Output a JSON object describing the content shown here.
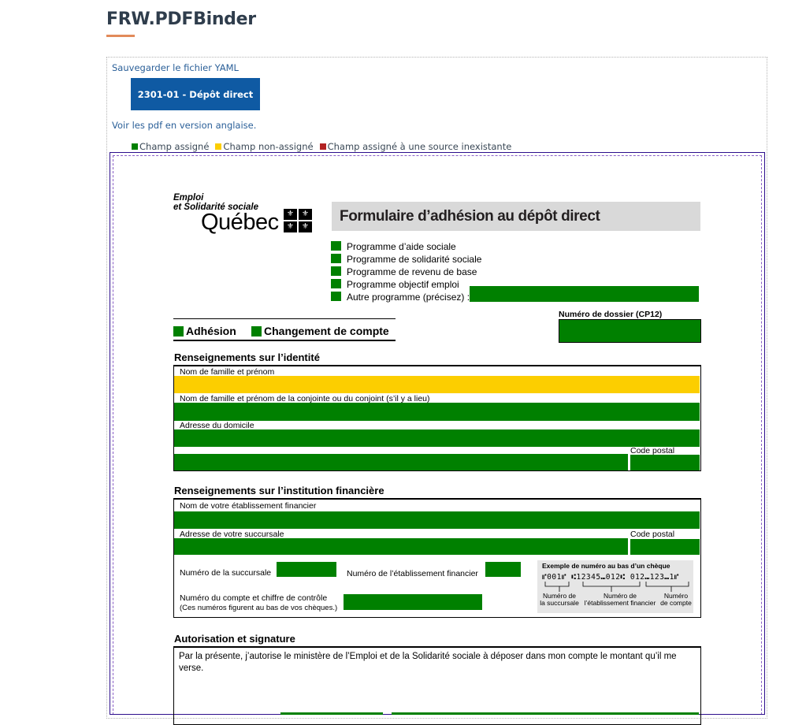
{
  "app": {
    "title": "FRW.PDFBinder"
  },
  "links": {
    "save_yaml": "Sauvegarder le fichier YAML",
    "view_english": "Voir les pdf en version anglaise."
  },
  "document_button": {
    "label": "2301-01 - Dépôt direct"
  },
  "legend": {
    "items": [
      {
        "label": "Champ assigné",
        "color": "#008000"
      },
      {
        "label": "Champ non-assigné",
        "color": "#fcce00"
      },
      {
        "label": "Champ assigné à une source inexistante",
        "color": "#b22222"
      }
    ]
  },
  "pdf": {
    "org_line1": "Emploi",
    "org_line2": "et Solidarité sociale",
    "province": "Québec",
    "form_title": "Formulaire d’adhésion au dépôt direct",
    "programs": [
      "Programme d’aide sociale",
      "Programme de solidarité sociale",
      "Programme de revenu de base",
      "Programme objectif emploi",
      "Autre programme (précisez) :"
    ],
    "file_number_label": "Numéro de dossier (CP12)",
    "adhesion_label": "Adhésion",
    "change_account_label": "Changement de compte",
    "identity": {
      "heading": "Renseignements sur l’identité",
      "name_label": "Nom de famille et prénom",
      "spouse_label": "Nom de famille et prénom de la conjointe ou du conjoint (s’il y a lieu)",
      "address_label": "Adresse du domicile",
      "postal_label": "Code postal"
    },
    "bank": {
      "heading": "Renseignements sur l’institution financière",
      "institution_label": "Nom de votre établissement financier",
      "branch_address_label": "Adresse de votre succursale",
      "postal_label": "Code postal",
      "branch_number_label": "Numéro de la succursale",
      "institution_number_label": "Numéro de l’établissement financier",
      "account_label": "Numéro du compte et chiffre de contrôle",
      "account_note": "(Ces numéros figurent au bas de vos chèques.)",
      "cheque_example_title": "Exemple de numéro au bas d’un chèque",
      "cheque_micr": "⑈001⑈  ⑆12345⑉012⑆  012⑉123⑉1⑈",
      "cheque_caption_branch_1": "Numéro de",
      "cheque_caption_branch_2": "la succursale",
      "cheque_caption_inst_1": "Numéro de",
      "cheque_caption_inst_2": "l’établissement financier",
      "cheque_caption_acct_1": "Numéro",
      "cheque_caption_acct_2": "de compte"
    },
    "authorization": {
      "heading": "Autorisation et signature",
      "text": "Par la présente, j’autorise le ministère de l’Emploi et de la Solidarité sociale à déposer dans mon compte le montant qu’il me verse."
    }
  }
}
